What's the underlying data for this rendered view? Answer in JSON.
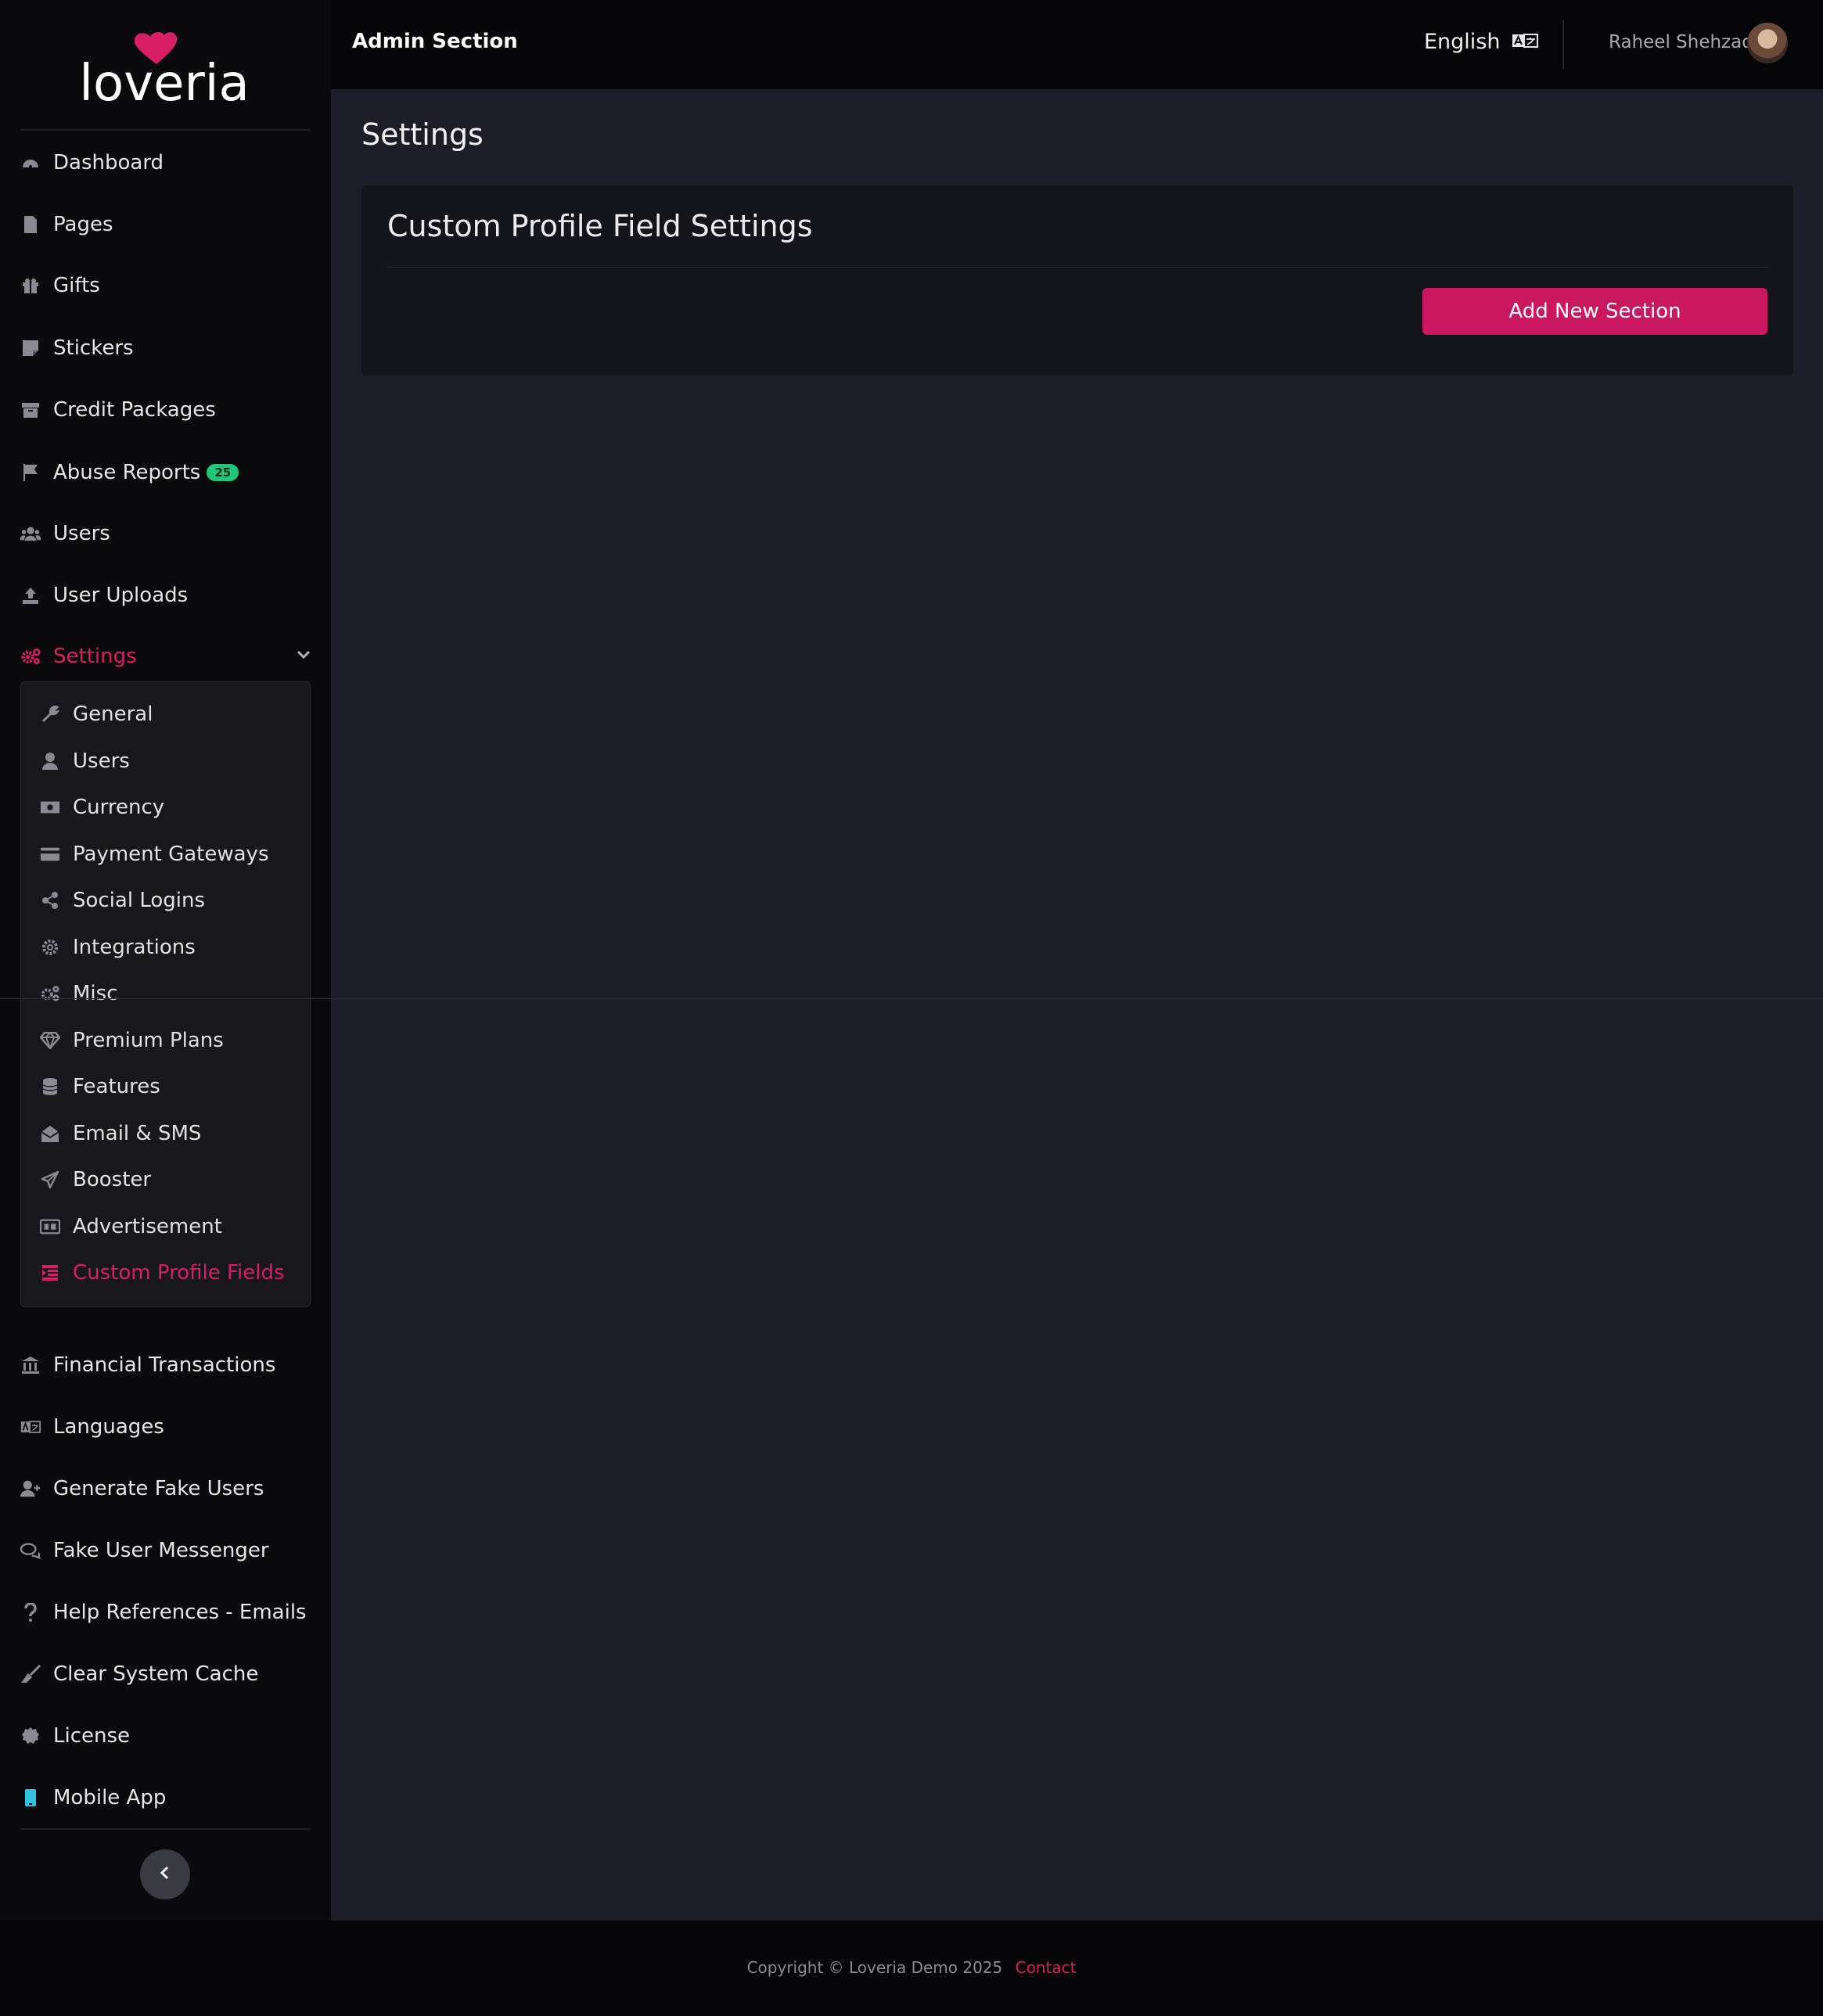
{
  "brand": {
    "name": "loveria",
    "accent": "#d81e64"
  },
  "header": {
    "title": "Admin Section",
    "language": "English",
    "language_icon": "language-icon",
    "user_name": "Raheel Shehzad"
  },
  "sidebar": {
    "items_top": [
      {
        "label": "Dashboard",
        "icon": "dashboard-icon"
      },
      {
        "label": "Pages",
        "icon": "file-icon"
      },
      {
        "label": "Gifts",
        "icon": "gift-icon"
      },
      {
        "label": "Stickers",
        "icon": "sticker-icon"
      },
      {
        "label": "Credit Packages",
        "icon": "box-icon"
      },
      {
        "label": "Abuse Reports",
        "icon": "flag-icon",
        "badge": "25"
      },
      {
        "label": "Users",
        "icon": "users-icon"
      },
      {
        "label": "User Uploads",
        "icon": "upload-icon"
      }
    ],
    "settings": {
      "label": "Settings",
      "icon": "cogs-icon"
    },
    "settings_sub": [
      {
        "label": "General",
        "icon": "wrench-icon"
      },
      {
        "label": "Users",
        "icon": "user-icon"
      },
      {
        "label": "Currency",
        "icon": "money-icon"
      },
      {
        "label": "Payment Gateways",
        "icon": "credit-card-icon"
      },
      {
        "label": "Social Logins",
        "icon": "share-icon"
      },
      {
        "label": "Integrations",
        "icon": "gear-icon"
      },
      {
        "label": "Misc",
        "icon": "cogs-icon"
      },
      {
        "label": "Premium Plans",
        "icon": "diamond-icon"
      },
      {
        "label": "Features",
        "icon": "database-icon"
      },
      {
        "label": "Email & SMS",
        "icon": "envelope-open-icon"
      },
      {
        "label": "Booster",
        "icon": "paper-plane-icon"
      },
      {
        "label": "Advertisement",
        "icon": "ad-icon"
      },
      {
        "label": "Custom Profile Fields",
        "icon": "list-icon",
        "active": true
      }
    ],
    "items_bottom": [
      {
        "label": "Financial Transactions",
        "icon": "bank-icon"
      },
      {
        "label": "Languages",
        "icon": "language-icon"
      },
      {
        "label": "Generate Fake Users",
        "icon": "user-plus-icon"
      },
      {
        "label": "Fake User Messenger",
        "icon": "comments-icon"
      },
      {
        "label": "Help References - Emails",
        "icon": "question-icon"
      },
      {
        "label": "Clear System Cache",
        "icon": "broom-icon"
      },
      {
        "label": "License",
        "icon": "certificate-icon"
      },
      {
        "label": "Mobile App",
        "icon": "mobile-icon"
      }
    ]
  },
  "main": {
    "page_title": "Settings",
    "card_title": "Custom Profile Field Settings",
    "add_button": "Add New Section"
  },
  "footer": {
    "copyright": "Copyright © Loveria Demo 2025",
    "contact": "Contact"
  }
}
